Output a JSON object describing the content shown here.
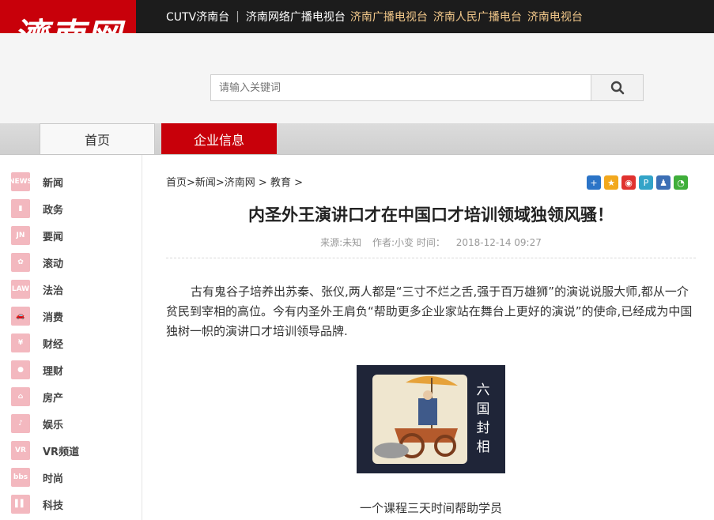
{
  "logo": {
    "text": "濟南网"
  },
  "topbar": {
    "station": "CUTV济南台",
    "divider": "|",
    "links": [
      "济南网络广播电视台",
      "济南广播电视台",
      "济南人民广播电台",
      "济南电视台"
    ]
  },
  "search": {
    "placeholder": "请输入关键词",
    "button_icon": "search-icon"
  },
  "nav": {
    "tabs": [
      {
        "label": "首页"
      },
      {
        "label": "企业信息"
      }
    ]
  },
  "sidebar": {
    "items": [
      {
        "label": "新闻",
        "icon": "news-icon",
        "icon_text": "NEWS"
      },
      {
        "label": "政务",
        "icon": "government-icon",
        "icon_text": "▮"
      },
      {
        "label": "要闻",
        "icon": "headline-icon",
        "icon_text": "JN"
      },
      {
        "label": "滚动",
        "icon": "scroll-icon",
        "icon_text": "✿"
      },
      {
        "label": "法治",
        "icon": "law-icon",
        "icon_text": "LAW"
      },
      {
        "label": "消费",
        "icon": "consume-icon",
        "icon_text": "🚗"
      },
      {
        "label": "财经",
        "icon": "finance-icon",
        "icon_text": "¥"
      },
      {
        "label": "理财",
        "icon": "money-icon",
        "icon_text": "●"
      },
      {
        "label": "房产",
        "icon": "house-icon",
        "icon_text": "⌂"
      },
      {
        "label": "娱乐",
        "icon": "entertainment-icon",
        "icon_text": "♪"
      },
      {
        "label": "VR频道",
        "icon": "vr-icon",
        "icon_text": "VR"
      },
      {
        "label": "时尚",
        "icon": "fashion-icon",
        "icon_text": "bbs"
      },
      {
        "label": "科技",
        "icon": "tech-icon",
        "icon_text": "▌▌"
      }
    ]
  },
  "article": {
    "breadcrumb": "首页>新闻>济南网 > 教育 >",
    "share_icons": [
      "plus-share-icon",
      "star-icon",
      "weibo-icon",
      "pinterest-icon",
      "people-icon",
      "wechat-icon"
    ],
    "title": "内圣外王演讲口才在中国口才培训领域独领风骚！",
    "source": "来源:未知",
    "author": "作者:小变",
    "time_label": "时间：",
    "time": "2018-12-14 09:27",
    "paragraph": "古有鬼谷子培养出苏秦、张仪,两人都是“三寸不烂之舌,强于百万雄狮”的演说说服大师,都从一介贫民到宰相的高位。今有内圣外王肩负“帮助更多企业家站在舞台上更好的演说”的使命,已经成为中国独树一帜的演讲口才培训领导品牌.",
    "image_caption": "六国封相",
    "caption": "一个课程三天时间帮助学员"
  },
  "colors": {
    "brand_red": "#c8000a",
    "topbar": "#1c1c1c",
    "icon_pink": "#f3b8bf"
  }
}
